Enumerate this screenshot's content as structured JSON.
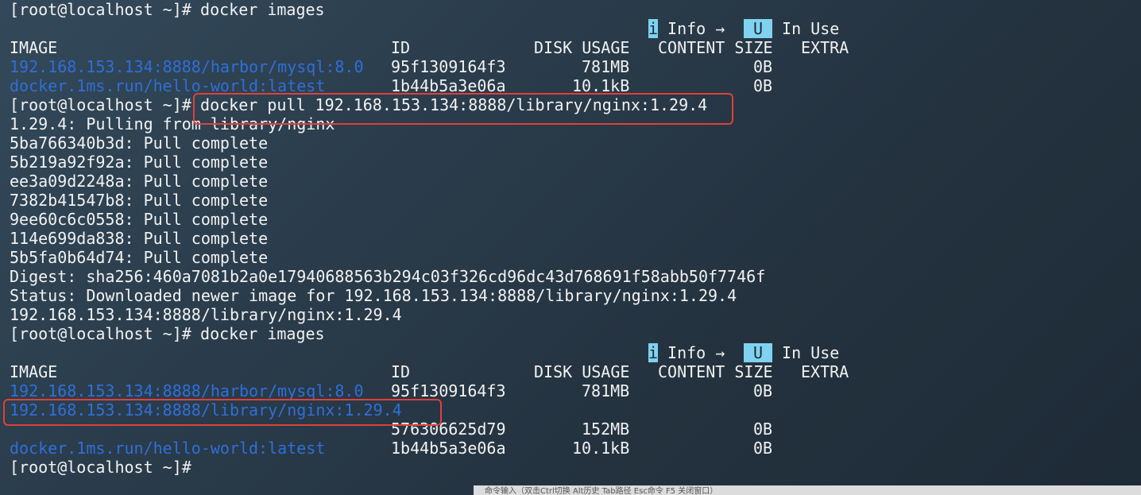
{
  "terminal": {
    "l1_prompt": "[root@localhost ~]#",
    "l1_cmd": " docker images",
    "l2_badge_i": "i",
    "l2_info": " Info → ",
    "l2_badge_u": " U ",
    "l2_inuse": " In Use",
    "h_image": "IMAGE",
    "h_id": "ID",
    "h_disk": "DISK USAGE",
    "h_content": "CONTENT SIZE",
    "h_extra": "EXTRA",
    "r1_image": "192.168.153.134:8888/harbor/mysql:8.0",
    "r1_id": "95f1309164f3",
    "r1_disk": "781MB",
    "r1_content": "0B",
    "r2_image": "docker.1ms.run/hello-world:latest",
    "r2_id": "1b44b5a3e06a",
    "r2_disk": "10.1kB",
    "r2_content": "0B",
    "l6_prompt": "[root@localhost ~]#",
    "l6_cmd": " docker pull 192.168.153.134:8888/library/nginx:1.29.4",
    "l7": "1.29.4: Pulling from library/nginx",
    "l8": "5ba766340b3d: Pull complete",
    "l9": "5b219a92f92a: Pull complete",
    "l10": "ee3a09d2248a: Pull complete",
    "l11": "7382b41547b8: Pull complete",
    "l12": "9ee60c6c0558: Pull complete",
    "l13": "114e699da838: Pull complete",
    "l14": "5b5fa0b64d74: Pull complete",
    "l15": "Digest: sha256:460a7081b2a0e17940688563b294c03f326cd96dc43d768691f58abb50f7746f",
    "l16": "Status: Downloaded newer image for 192.168.153.134:8888/library/nginx:1.29.4",
    "l17": "192.168.153.134:8888/library/nginx:1.29.4",
    "l18_prompt": "[root@localhost ~]#",
    "l18_cmd": " docker images",
    "l19_badge_i": "i",
    "l19_info": " Info → ",
    "l19_badge_u": " U ",
    "l19_inuse": " In Use",
    "h2_image": "IMAGE",
    "h2_id": "ID",
    "h2_disk": "DISK USAGE",
    "h2_content": "CONTENT SIZE",
    "h2_extra": "EXTRA",
    "s1_image": "192.168.153.134:8888/harbor/mysql:8.0",
    "s1_id": "95f1309164f3",
    "s1_disk": "781MB",
    "s1_content": "0B",
    "s2_image": "192.168.153.134:8888/library/nginx:1.29.4",
    "s3_id": "576306625d79",
    "s3_disk": "152MB",
    "s3_content": "0B",
    "s4_image": "docker.1ms.run/hello-world:latest",
    "s4_id": "1b44b5a3e06a",
    "s4_disk": "10.1kB",
    "s4_content": "0B",
    "l25_prompt": "[root@localhost ~]#"
  },
  "statusbar": {
    "text": "命令输入（双击Ctrl切换 Alt历史 Tab路径 Esc命令 F5 关闭窗口）"
  },
  "colors": {
    "text": "#f2f2f2",
    "link": "#2f6fd8",
    "badge": "#7fd3f0",
    "highlight": "#e0403a"
  }
}
